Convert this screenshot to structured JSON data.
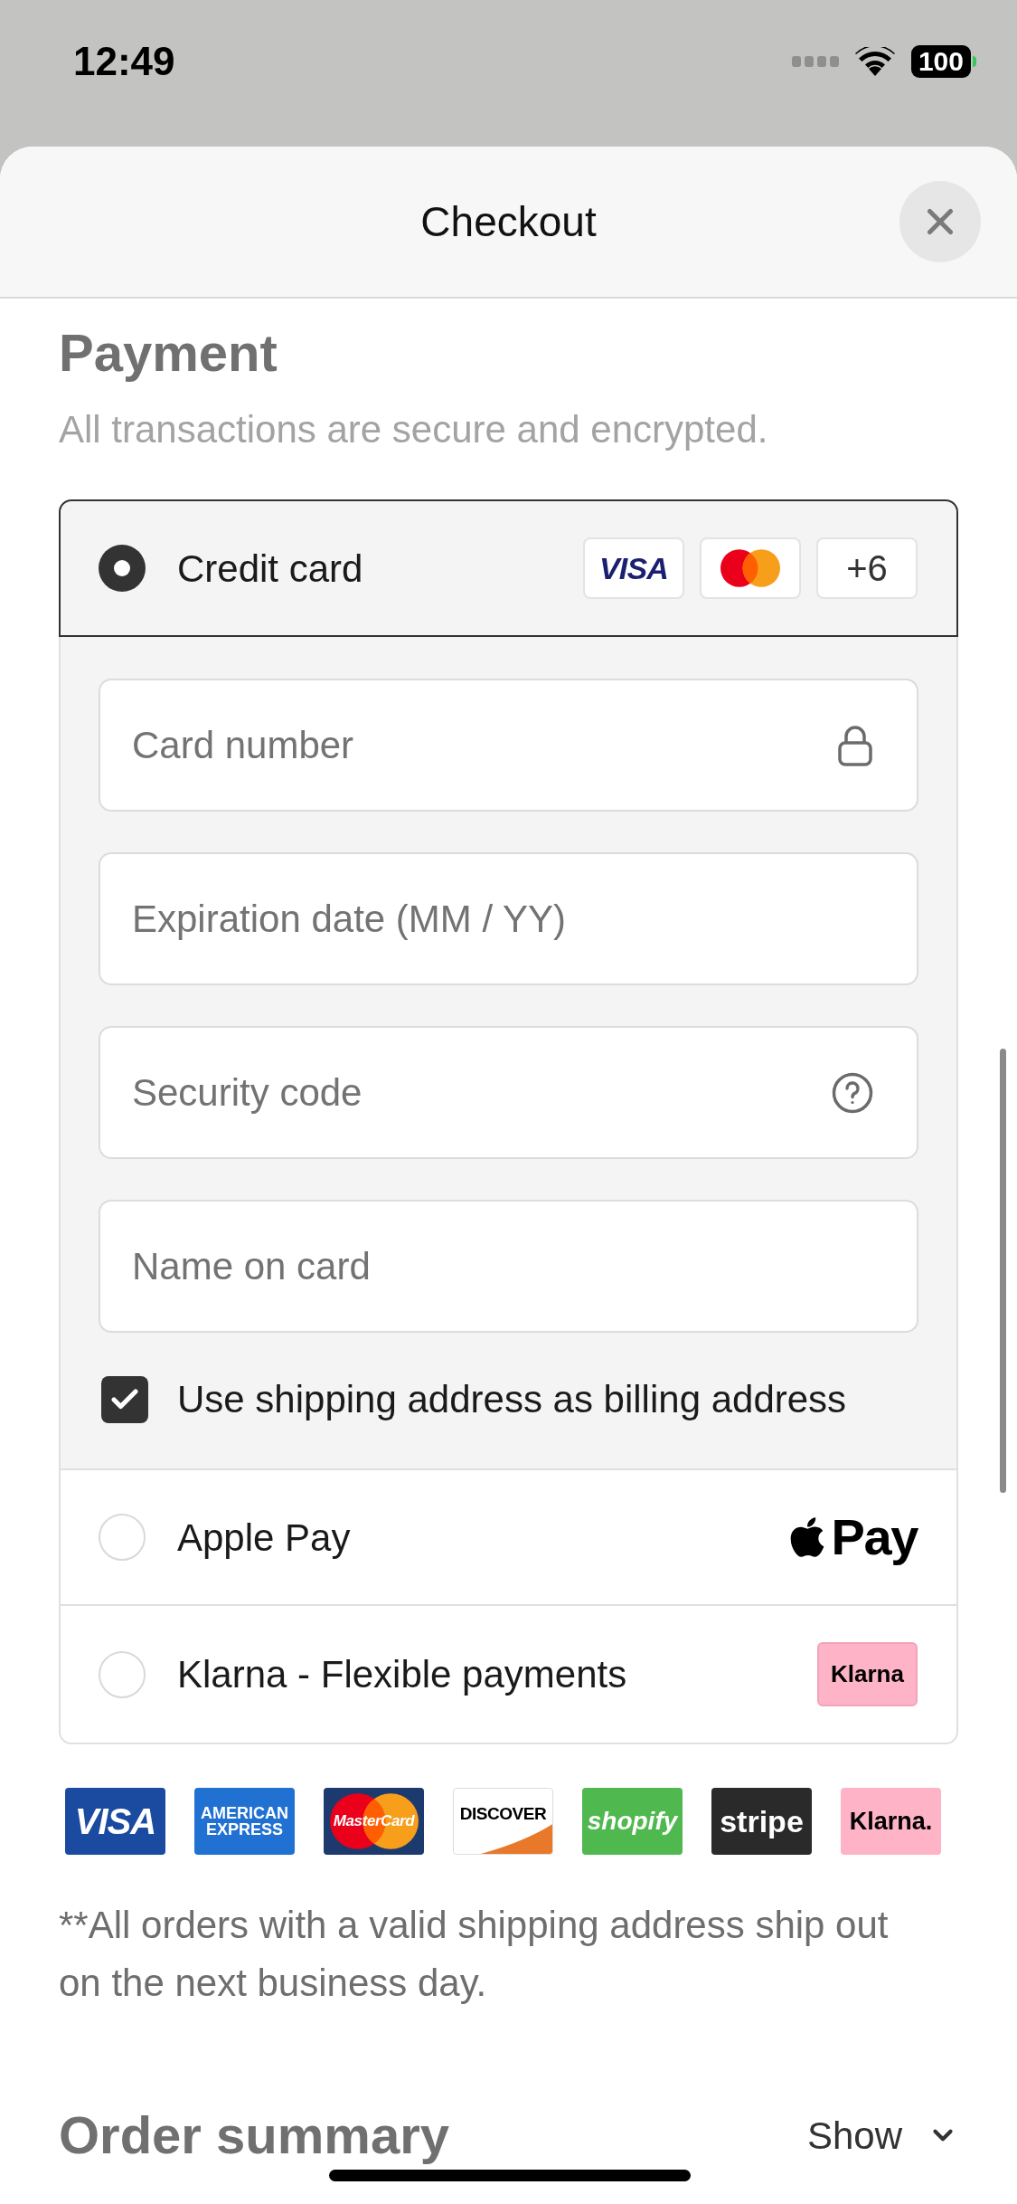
{
  "status_bar": {
    "time": "12:49",
    "battery": "100"
  },
  "sheet": {
    "title": "Checkout"
  },
  "payment": {
    "title": "Payment",
    "subtitle": "All transactions are secure and encrypted.",
    "methods": [
      {
        "kind": "card",
        "label": "Credit card",
        "selected": true,
        "badges": [
          {
            "kind": "visa",
            "text": "VISA"
          },
          {
            "kind": "mastercard"
          },
          {
            "kind": "more",
            "text": "+6"
          }
        ],
        "fields": [
          {
            "kind": "card_number",
            "placeholder": "Card number"
          },
          {
            "kind": "expiry",
            "placeholder": "Expiration date (MM / YY)"
          },
          {
            "kind": "security_code",
            "placeholder": "Security code"
          },
          {
            "kind": "name",
            "placeholder": "Name on card"
          }
        ],
        "billing_same": {
          "label": "Use shipping address as billing address",
          "checked": true
        }
      },
      {
        "kind": "apple_pay",
        "label": "Apple Pay",
        "selected": false,
        "logo_text": "Pay"
      },
      {
        "kind": "klarna",
        "label": "Klarna - Flexible payments",
        "selected": false,
        "logo_text": "Klarna"
      }
    ]
  },
  "accepted_logos": [
    {
      "kind": "visa",
      "text": "VISA"
    },
    {
      "kind": "amex",
      "text": "AMERICAN EXPRESS"
    },
    {
      "kind": "mastercard",
      "text": "MasterCard"
    },
    {
      "kind": "discover",
      "text": "DISCOVER"
    },
    {
      "kind": "shopify",
      "text": "shopify"
    },
    {
      "kind": "stripe",
      "text": "stripe"
    },
    {
      "kind": "klarna",
      "text": "Klarna."
    }
  ],
  "note": "**All orders with a valid shipping address ship out on the next business day.",
  "order_summary": {
    "title": "Order summary",
    "toggle": "Show"
  }
}
